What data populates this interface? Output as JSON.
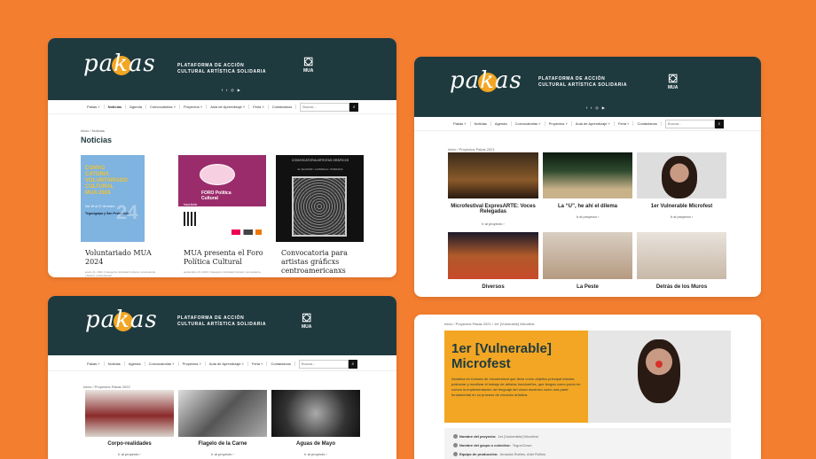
{
  "brand": {
    "logo": "pakas",
    "tagline1": "PLATAFORMA DE ACCIÓN",
    "tagline2": "CULTURAL ARTÍSTICA SOLIDARIA",
    "mua": "MUA",
    "accent": "#F2A623",
    "header_bg": "#1F3A3F",
    "page_bg": "#F47E30",
    "social_icons": [
      "facebook-icon",
      "twitter-icon",
      "instagram-icon",
      "youtube-icon"
    ]
  },
  "nav": {
    "items": [
      "Pakas ˅",
      "Noticias",
      "Agenda",
      "Convocatorias ˅",
      "Proyectos ˅",
      "Aula de Aprendizaje ˅",
      "Feria ˅",
      "Contáctanos"
    ],
    "search_placeholder": "Buscar...",
    "search_btn": "⌕"
  },
  "noticias": {
    "crumb": "Inicio / Noticias",
    "title": "Noticias",
    "items": [
      {
        "title": "Voluntariado MUA 2024",
        "meta": "enero 11, 2024 | Categoría: Actividad Cultural, convocatoria | Abierto | Voluntariado",
        "poster": "CONVO CATORIA VOLUNTARIADO CULTURAL MUA 2024",
        "poster_sub": "Del 15 al 27 de enero",
        "poster_place": "Tegucigalpa y San Pedro Sula"
      },
      {
        "title": "MUA presenta el Foro Política Cultural",
        "meta": "septiembre 13, 2023 | Categoría: Actividad Cultural, convocatoria",
        "poster": "FORO Política Cultural",
        "poster_sub": "Inscríbete",
        "poster_place": ""
      },
      {
        "title": "Convocatoria para artistas gráficxs centroamericanxs",
        "meta": "",
        "poster": "CONVOCATORIA ARTISTAS GRÁFICXS",
        "poster_sub": "EL SALVADOR • GUATEMALA • HONDURAS",
        "poster_place": ""
      }
    ]
  },
  "proyectos2021": {
    "crumb": "Inicio / Proyectos Pakas 2021",
    "items": [
      {
        "title": "Microfestival ExpresARTE: Voces Relegadas",
        "link": "Ir al proyecto ›"
      },
      {
        "title": "La “U”, he ahí el dilema",
        "link": "Ir al proyecto ›"
      },
      {
        "title": "1er Vulnerable Microfest",
        "link": "Ir al proyecto ›"
      },
      {
        "title": "Diversos",
        "link": ""
      },
      {
        "title": "La Peste",
        "link": ""
      },
      {
        "title": "Detrás de los Muros",
        "link": ""
      }
    ]
  },
  "proyectos2022": {
    "crumb": "Inicio / Proyectos Pakas 2022",
    "items": [
      {
        "title": "Corpo-realidades",
        "link": "Ir al proyecto ›"
      },
      {
        "title": "Flagelo de la Carne",
        "link": "Ir al proyecto ›"
      },
      {
        "title": "Aguas de Mayo",
        "link": "Ir al proyecto ›"
      }
    ]
  },
  "detalle": {
    "crumb": "Inicio / Proyectos Pakas 2021 / 1er [Vulnerable] Microfest",
    "title": "1er [Vulnerable] Microfest",
    "description": "Iniciativa en formato de microfestival que tiene como objetivo principal instalar, potenciar y movilizar el trabajo de artistas hondureñxs, que tengan como punto en común la implementación del lenguaje del clown escénico como una parte fundamental en su proceso de creación artística.",
    "fields": [
      {
        "label": "Nombre del proyecto:",
        "value": "1er [Vulnerable] Microfest"
      },
      {
        "label": "Nombre del grupo o colectivo:",
        "value": "TeguzClown"
      },
      {
        "label": "Equipo de producción:",
        "value": "Amanda Robles, Ariel Rollins"
      }
    ]
  }
}
